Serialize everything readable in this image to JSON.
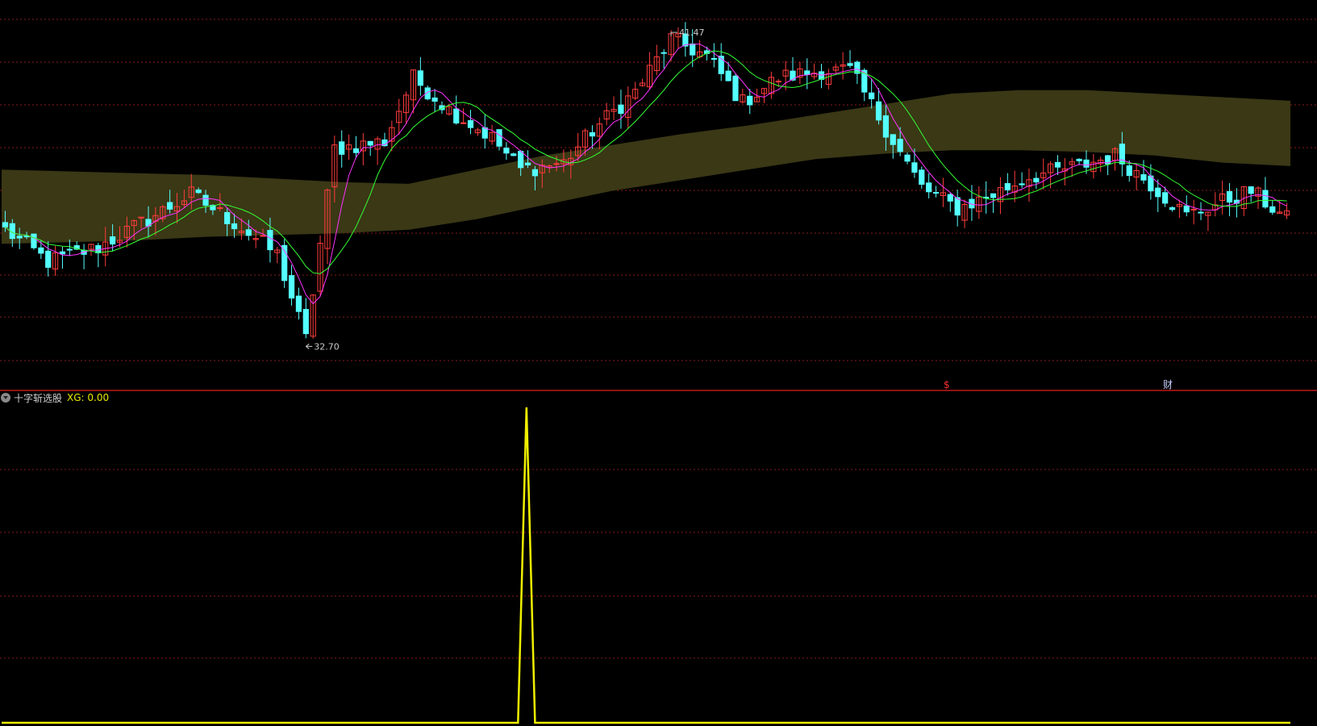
{
  "indicator_panel": {
    "name": "十字斩选股",
    "xg_label": "XG: 0.00"
  },
  "markers": {
    "left": "$",
    "right": "财"
  },
  "colors": {
    "up": "#ff3c3c",
    "down": "#54ffff",
    "ma_fast": "#ff33ff",
    "ma_slow": "#33ff33",
    "band": "#3a3815",
    "grid": "#8b1a1a",
    "separator": "#c01818",
    "signal": "#f0f000"
  },
  "chart_data": [
    {
      "type": "candlestick",
      "title": "",
      "y_range": [
        31.5,
        42.5
      ],
      "grid": "dotted-horizontal",
      "high_annotation": {
        "label": "41.47",
        "value": 41.47
      },
      "low_annotation": {
        "label": "32.70",
        "value": 32.7
      },
      "band_lower": [
        35.6,
        35.65,
        35.7,
        35.8,
        35.85,
        35.9,
        36.0,
        36.3,
        36.7,
        37.1,
        37.4,
        37.7,
        38.0,
        38.15,
        38.25,
        38.25,
        38.2,
        38.1,
        37.9,
        37.8
      ],
      "band_upper": [
        37.7,
        37.65,
        37.6,
        37.55,
        37.45,
        37.35,
        37.3,
        37.7,
        38.1,
        38.4,
        38.7,
        38.95,
        39.25,
        39.55,
        39.85,
        39.95,
        39.95,
        39.85,
        39.75,
        39.65
      ]
    },
    {
      "type": "line",
      "title": "",
      "y_range": [
        0,
        1
      ],
      "series": [
        {
          "peak_index": 123,
          "count": 303,
          "peak_value": 1
        }
      ]
    }
  ]
}
